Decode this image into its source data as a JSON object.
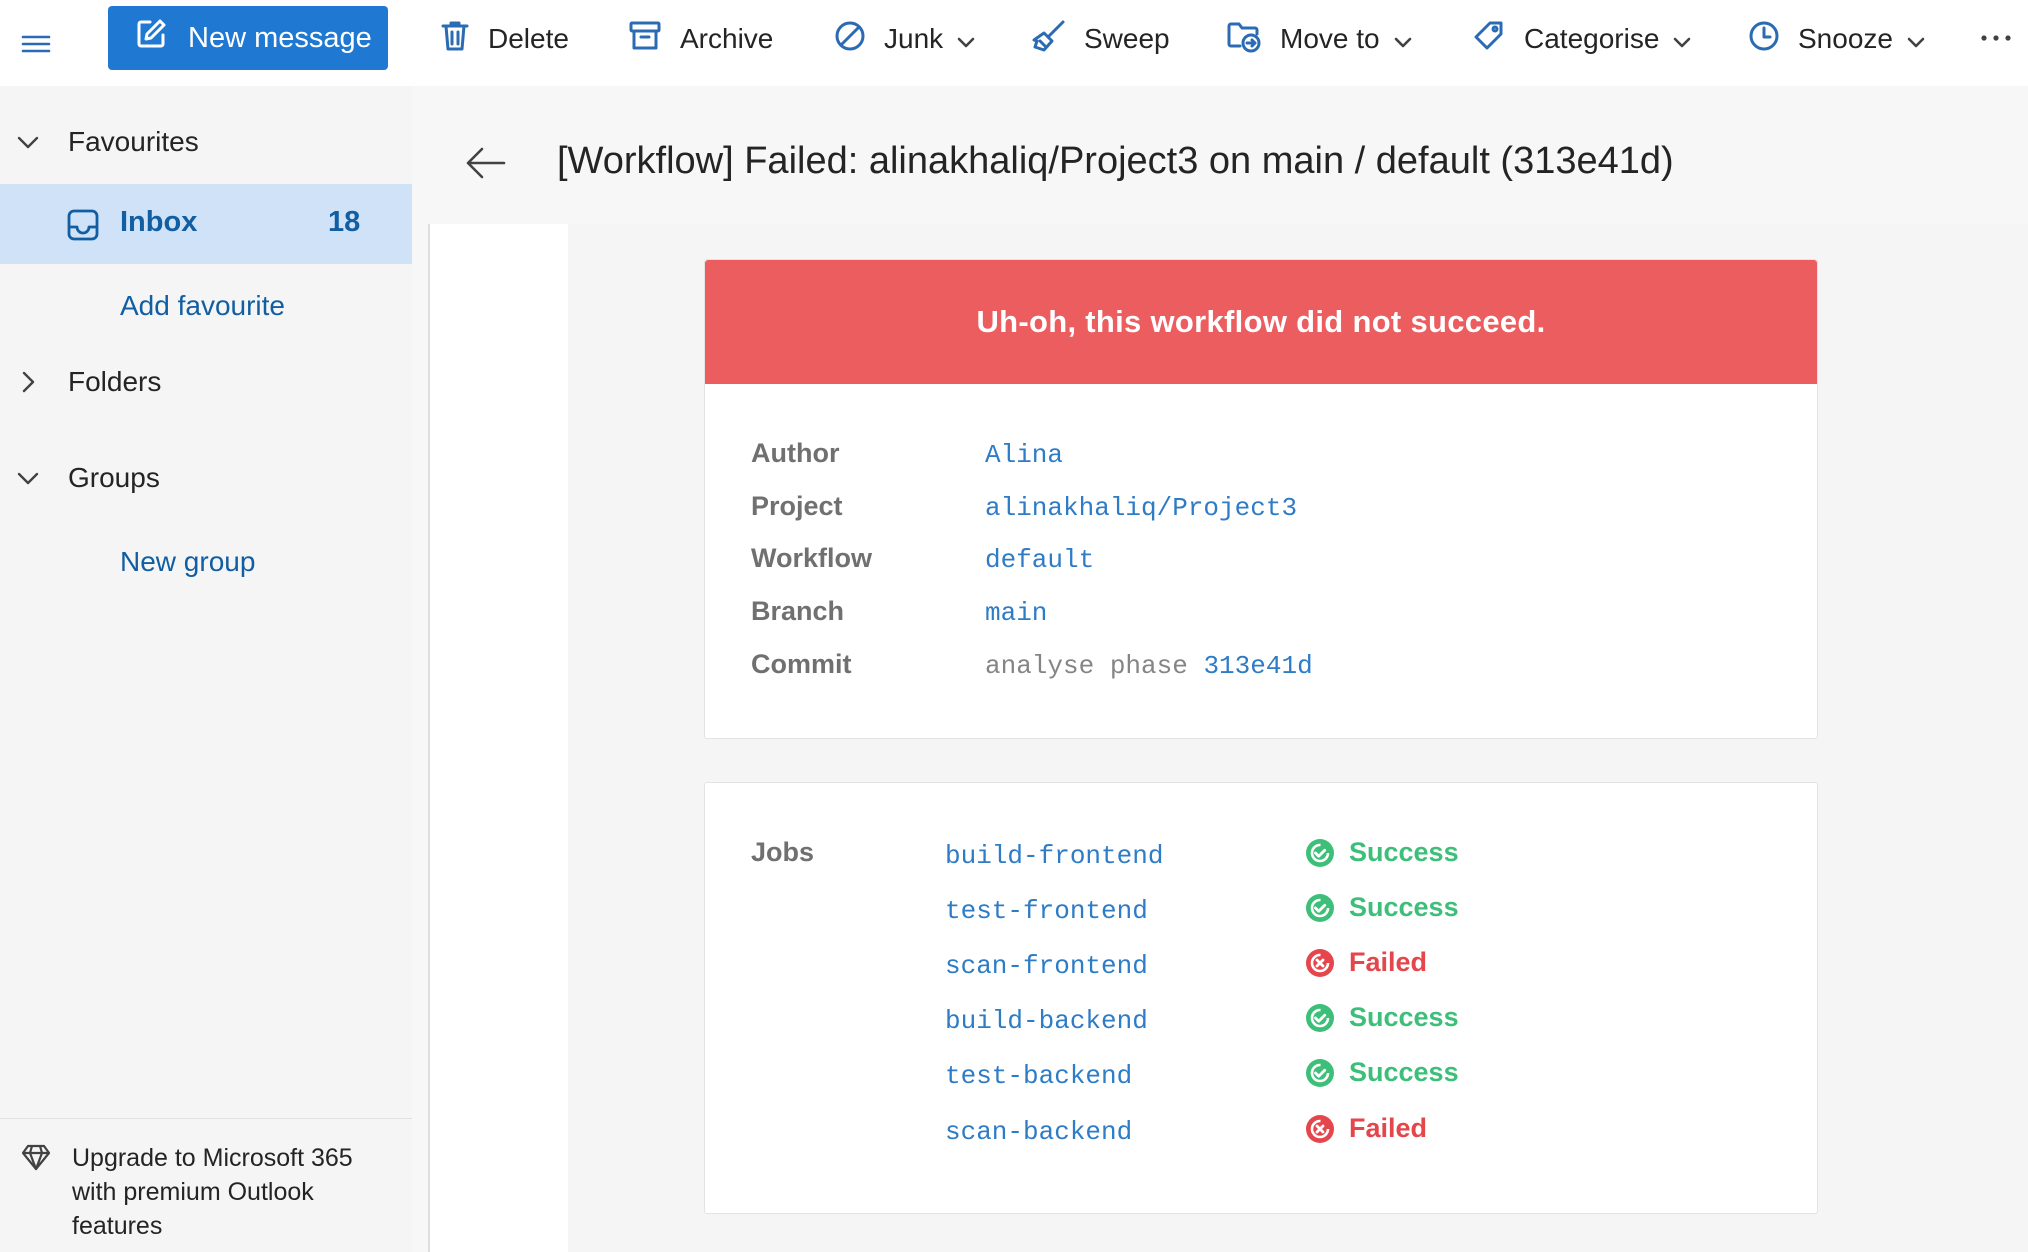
{
  "toolbar": {
    "menu_icon": "hamburger-icon",
    "new_message": "New message",
    "delete": "Delete",
    "archive": "Archive",
    "junk": "Junk",
    "sweep": "Sweep",
    "move_to": "Move to",
    "categorise": "Categorise",
    "snooze": "Snooze",
    "more_icon": "more-icon"
  },
  "sidebar": {
    "favourites": "Favourites",
    "inbox": {
      "label": "Inbox",
      "count": "18"
    },
    "add_favourite": "Add favourite",
    "folders": "Folders",
    "groups": "Groups",
    "new_group": "New group",
    "upgrade": "Upgrade to Microsoft 365 with premium Outlook features"
  },
  "message": {
    "subject": "[Workflow] Failed: alinakhaliq/Project3 on main / default (313e41d)",
    "banner": "Uh-oh, this workflow did not succeed.",
    "details": {
      "author_label": "Author",
      "author": "Alina",
      "project_label": "Project",
      "project": "alinakhaliq/Project3",
      "workflow_label": "Workflow",
      "workflow": "default",
      "branch_label": "Branch",
      "branch": "main",
      "commit_label": "Commit",
      "commit_message": "analyse phase",
      "commit_hash": "313e41d"
    },
    "jobs_label": "Jobs",
    "jobs": [
      {
        "name": "build-frontend",
        "status": "Success"
      },
      {
        "name": "test-frontend",
        "status": "Success"
      },
      {
        "name": "scan-frontend",
        "status": "Failed"
      },
      {
        "name": "build-backend",
        "status": "Success"
      },
      {
        "name": "test-backend",
        "status": "Success"
      },
      {
        "name": "scan-backend",
        "status": "Failed"
      }
    ]
  },
  "colors": {
    "accent": "#1f78d1",
    "banner_failed": "#ec5d5f",
    "status_success": "#3dbf7a",
    "status_failed": "#e4464c",
    "link": "#2e7cc6"
  }
}
